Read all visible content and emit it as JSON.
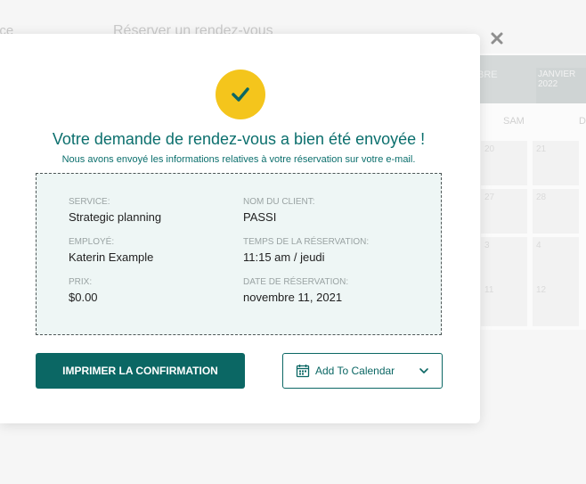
{
  "background": {
    "left_text": "ice",
    "page_title": "Réserver un rendez-vous",
    "calendar": {
      "month_prev": "BRE",
      "month_current": "JANVIER",
      "year_current": "2022",
      "dow_sat": "SAM",
      "dow_next": "D",
      "cells": [
        "20",
        "21",
        "27",
        "28",
        "3",
        "4",
        "11",
        "12"
      ]
    }
  },
  "modal": {
    "title": "Votre demande de rendez-vous a bien été envoyée !",
    "subtitle": "Nous avons envoyé les informations relatives à votre réservation sur votre e-mail.",
    "details": {
      "service_label": "SERVICE:",
      "service_value": "Strategic planning",
      "employee_label": "EMPLOYÉ:",
      "employee_value": "Katerin Example",
      "price_label": "PRIX:",
      "price_value": "$0.00",
      "client_label": "NOM DU CLIENT:",
      "client_value": "PASSI",
      "time_label": "TEMPS DE LA RÉSERVATION:",
      "time_value": "11:15 am / jeudi",
      "date_label": "DATE DE RÉSERVATION:",
      "date_value": "novembre 11, 2021"
    },
    "print_button": "IMPRIMER LA CONFIRMATION",
    "calendar_button": "Add To Calendar"
  },
  "icons": {
    "close": "close-icon",
    "success": "checkmark-icon",
    "calendar": "calendar-icon",
    "dropdown": "chevron-down-icon"
  },
  "colors": {
    "accent": "#0b6764",
    "check_circle": "#f4c51c",
    "details_bg": "#eef6f5"
  }
}
